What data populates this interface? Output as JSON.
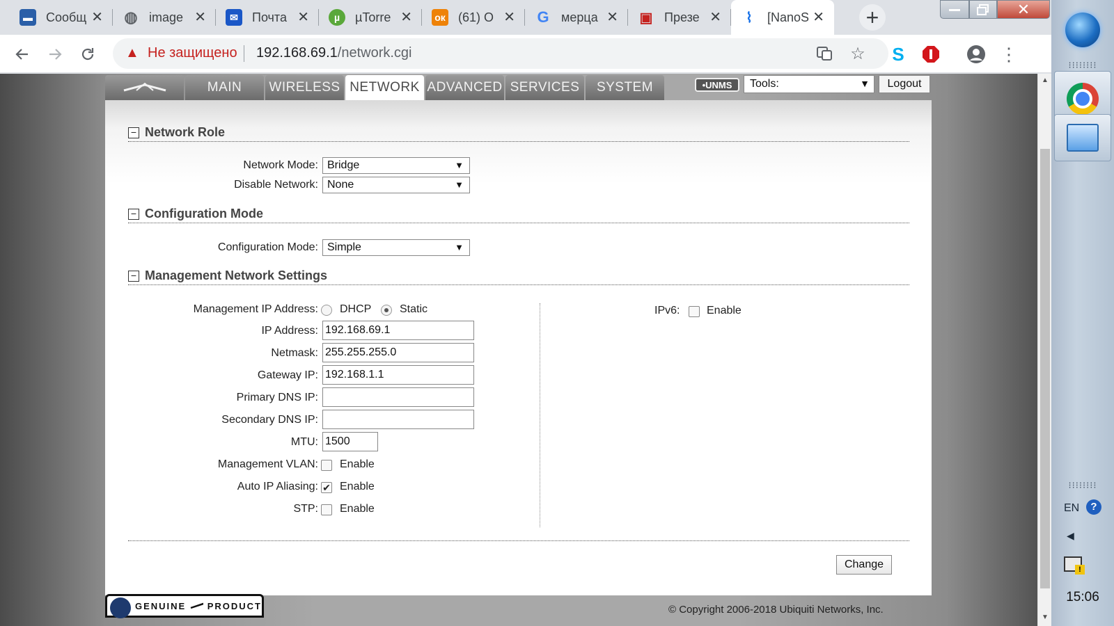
{
  "browser": {
    "tabs": [
      {
        "title": "Сообщ",
        "icon": "chat-icon",
        "color": "#2a5fa8",
        "active": false
      },
      {
        "title": "image",
        "icon": "globe-icon",
        "color": "#5f6368",
        "active": false
      },
      {
        "title": "Почта",
        "icon": "mail-icon",
        "color": "#1a57c7",
        "active": false
      },
      {
        "title": "µTorre",
        "icon": "utorrent-icon",
        "color": "#5aa83a",
        "active": false
      },
      {
        "title": "(61) О",
        "icon": "ok-icon",
        "color": "#ee8208",
        "active": false
      },
      {
        "title": "мерца",
        "icon": "google-icon",
        "color": "#4285f4",
        "active": false
      },
      {
        "title": "Презе",
        "icon": "slides-icon",
        "color": "#c5221f",
        "active": false
      },
      {
        "title": "[NanoS",
        "icon": "rss-icon",
        "color": "#1a73e8",
        "active": true
      }
    ],
    "security_label": "Не защищено",
    "url_host": "192.168.69.1",
    "url_path": "/network.cgi"
  },
  "nav": {
    "tabs": [
      "MAIN",
      "WIRELESS",
      "NETWORK",
      "ADVANCED",
      "SERVICES",
      "SYSTEM"
    ],
    "active_tab": "NETWORK",
    "logo": "ubiquiti-logo-icon",
    "unms_label": "UNMS",
    "tools_label": "Tools:",
    "logout_label": "Logout"
  },
  "sections": {
    "network_role": {
      "title": "Network Role",
      "network_mode_label": "Network Mode:",
      "network_mode_value": "Bridge",
      "disable_network_label": "Disable Network:",
      "disable_network_value": "None"
    },
    "configuration_mode": {
      "title": "Configuration Mode",
      "label": "Configuration Mode:",
      "value": "Simple"
    },
    "management": {
      "title": "Management Network Settings",
      "mgmt_ip_label": "Management IP Address:",
      "dhcp_label": "DHCP",
      "static_label": "Static",
      "selected_mode": "Static",
      "ip_label": "IP Address:",
      "ip_value": "192.168.69.1",
      "netmask_label": "Netmask:",
      "netmask_value": "255.255.255.0",
      "gateway_label": "Gateway IP:",
      "gateway_value": "192.168.1.1",
      "primary_dns_label": "Primary DNS IP:",
      "primary_dns_value": "",
      "secondary_dns_label": "Secondary DNS IP:",
      "secondary_dns_value": "",
      "mtu_label": "MTU:",
      "mtu_value": "1500",
      "vlan_label": "Management VLAN:",
      "vlan_enable_label": "Enable",
      "vlan_enabled": false,
      "aliasing_label": "Auto IP Aliasing:",
      "aliasing_enable_label": "Enable",
      "aliasing_enabled": true,
      "stp_label": "STP:",
      "stp_enable_label": "Enable",
      "stp_enabled": false,
      "ipv6_label": "IPv6:",
      "ipv6_enable_label": "Enable",
      "ipv6_enabled": false
    }
  },
  "change_label": "Change",
  "footer": {
    "genuine_label": "GENUINE",
    "product_label": "PRODUCT",
    "copyright": "© Copyright 2006-2018 Ubiquiti Networks, Inc."
  },
  "taskbar": {
    "language": "EN",
    "time": "15:06"
  }
}
